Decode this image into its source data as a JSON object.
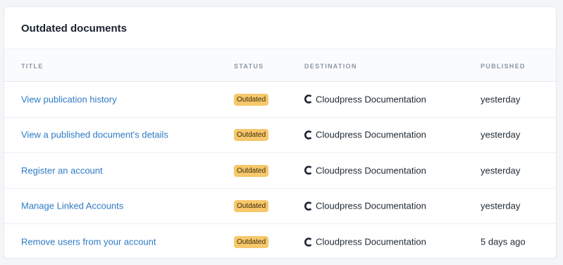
{
  "header": {
    "title": "Outdated documents"
  },
  "columns": {
    "title": "TITLE",
    "status": "STATUS",
    "destination": "DESTINATION",
    "published": "PUBLISHED"
  },
  "colors": {
    "link": "#2e7bc4",
    "badge_bg": "#f6c76b",
    "logo": "#1a2330"
  },
  "rows": [
    {
      "title": "View publication history",
      "status": "Outdated",
      "destination": "Cloudpress Documentation",
      "destination_icon": "cloudpress-logo-icon",
      "published": "yesterday"
    },
    {
      "title": "View a published document's details",
      "status": "Outdated",
      "destination": "Cloudpress Documentation",
      "destination_icon": "cloudpress-logo-icon",
      "published": "yesterday"
    },
    {
      "title": "Register an account",
      "status": "Outdated",
      "destination": "Cloudpress Documentation",
      "destination_icon": "cloudpress-logo-icon",
      "published": "yesterday"
    },
    {
      "title": "Manage Linked Accounts",
      "status": "Outdated",
      "destination": "Cloudpress Documentation",
      "destination_icon": "cloudpress-logo-icon",
      "published": "yesterday"
    },
    {
      "title": "Remove users from your account",
      "status": "Outdated",
      "destination": "Cloudpress Documentation",
      "destination_icon": "cloudpress-logo-icon",
      "published": "5 days ago"
    }
  ]
}
